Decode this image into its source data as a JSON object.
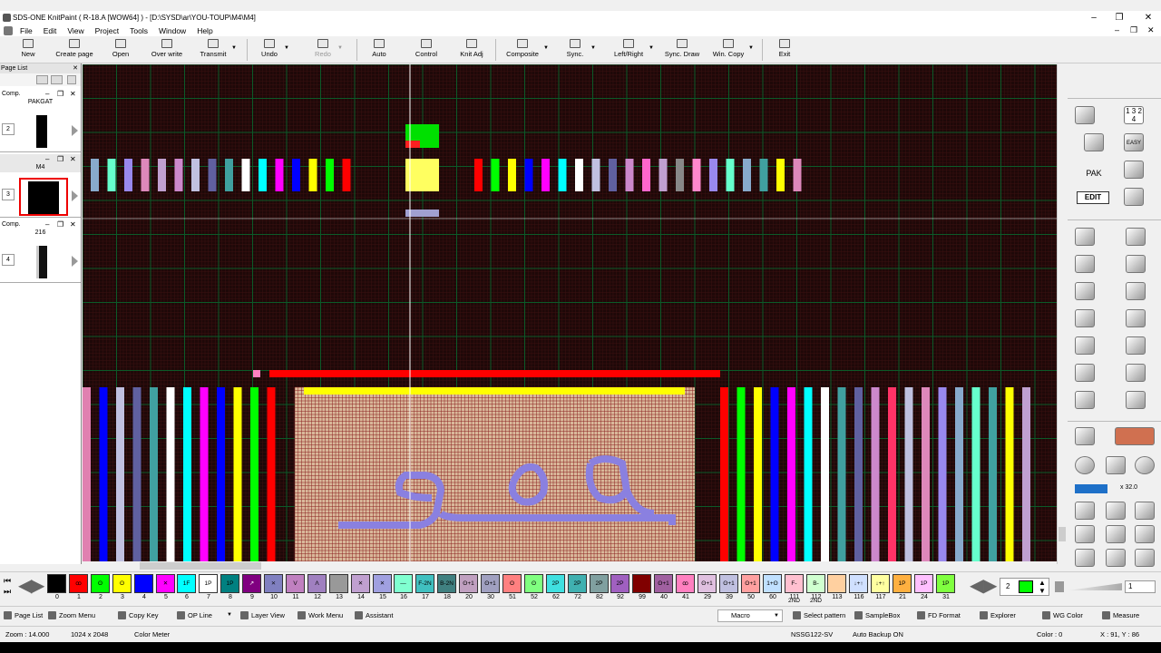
{
  "window": {
    "title": "SDS-ONE KnitPaint ( R-18.A [WOW64] ) - [D:\\SYSD\\ar\\YOU-TOUP\\M4\\M4]",
    "minimize": "–",
    "maximize": "❐",
    "close": "✕"
  },
  "menu": {
    "items": [
      "File",
      "Edit",
      "View",
      "Project",
      "Tools",
      "Window",
      "Help"
    ],
    "win_min": "–",
    "win_max": "❐",
    "win_close": "✕"
  },
  "toolbar": {
    "new": "New",
    "create_page": "Create page",
    "open": "Open",
    "overwrite": "Over write",
    "transmit": "Transmit",
    "undo": "Undo",
    "redo": "Redo",
    "auto": "Auto",
    "control": "Control",
    "knit_adj": "Knit Adj",
    "composite": "Composite",
    "sync": "Sync.",
    "left_right": "Left/Right",
    "sync_draw": "Sync. Draw",
    "win_copy": "Win. Copy",
    "exit": "Exit"
  },
  "page_list": {
    "title": "Page List",
    "pages": [
      {
        "tag": "Comp.",
        "name": "PAKGAT",
        "number": "2"
      },
      {
        "tag": "",
        "name": "M4",
        "number": "3"
      },
      {
        "tag": "Comp.",
        "name": "216",
        "number": "4"
      }
    ]
  },
  "right_panel": {
    "pak_label": "PAK",
    "edit_label": "EDIT",
    "easy_label": "EASY",
    "numbers_label": "1 3 2 4",
    "zoom_scale": "x 32.0"
  },
  "palette": {
    "colors": [
      {
        "label": "0",
        "bg": "#000000",
        "sym": ""
      },
      {
        "label": "1",
        "bg": "#ff0000",
        "sym": "ꝏ"
      },
      {
        "label": "2",
        "bg": "#00ff00",
        "sym": "ʘ"
      },
      {
        "label": "3",
        "bg": "#ffff00",
        "sym": "ʘ"
      },
      {
        "label": "4",
        "bg": "#0000ff",
        "sym": ""
      },
      {
        "label": "5",
        "bg": "#ff00ff",
        "sym": "✕"
      },
      {
        "label": "6",
        "bg": "#00ffff",
        "sym": "1F"
      },
      {
        "label": "7",
        "bg": "#ffffff",
        "sym": "1P"
      },
      {
        "label": "8",
        "bg": "#008080",
        "sym": "1P"
      },
      {
        "label": "9",
        "bg": "#800080",
        "sym": "↗"
      },
      {
        "label": "10",
        "bg": "#8080c0",
        "sym": "⨯"
      },
      {
        "label": "11",
        "bg": "#c080c0",
        "sym": "V"
      },
      {
        "label": "12",
        "bg": "#a080c0",
        "sym": "Λ"
      },
      {
        "label": "13",
        "bg": "#999999",
        "sym": ""
      },
      {
        "label": "14",
        "bg": "#c0a0d0",
        "sym": "✕"
      },
      {
        "label": "15",
        "bg": "#a0a0e0",
        "sym": "✕"
      },
      {
        "label": "16",
        "bg": "#80ffd0",
        "sym": "—"
      },
      {
        "label": "17",
        "bg": "#40c0c0",
        "sym": "F-2N"
      },
      {
        "label": "18",
        "bg": "#408080",
        "sym": "B-2N"
      },
      {
        "label": "20",
        "bg": "#c0a0c0",
        "sym": "ʘ+1"
      },
      {
        "label": "30",
        "bg": "#a0a0c0",
        "sym": "ʘ+1"
      },
      {
        "label": "51",
        "bg": "#ff8080",
        "sym": "ʘ"
      },
      {
        "label": "52",
        "bg": "#80ff80",
        "sym": "ʘ"
      },
      {
        "label": "62",
        "bg": "#40e0e0",
        "sym": "2P"
      },
      {
        "label": "72",
        "bg": "#40b0b0",
        "sym": "2P"
      },
      {
        "label": "82",
        "bg": "#80a0a0",
        "sym": "2P"
      },
      {
        "label": "92",
        "bg": "#a060c0",
        "sym": "2P"
      },
      {
        "label": "99",
        "bg": "#800000",
        "sym": ""
      },
      {
        "label": "40",
        "bg": "#a060a0",
        "sym": "ʘ+1"
      },
      {
        "label": "41",
        "bg": "#ff80c0",
        "sym": "ꝏ"
      },
      {
        "label": "29",
        "bg": "#e0c0e0",
        "sym": "ʘ+1"
      },
      {
        "label": "39",
        "bg": "#c0c0e0",
        "sym": "ʘ+1"
      },
      {
        "label": "50",
        "bg": "#ffa0a0",
        "sym": "ʘ+1"
      },
      {
        "label": "60",
        "bg": "#c0e0ff",
        "sym": "1+ʘ"
      },
      {
        "label": "111",
        "bg": "#ffc0d0",
        "sym": "F-2ND"
      },
      {
        "label": "112",
        "bg": "#d0ffd0",
        "sym": "B-2ND"
      },
      {
        "label": "113",
        "bg": "#ffd0a0",
        "sym": ""
      },
      {
        "label": "116",
        "bg": "#d0e0ff",
        "sym": "↓+↑"
      },
      {
        "label": "117",
        "bg": "#ffffa0",
        "sym": "↓+↑"
      },
      {
        "label": "21",
        "bg": "#ffb040",
        "sym": "1P"
      },
      {
        "label": "24",
        "bg": "#ffc0ff",
        "sym": "1P"
      },
      {
        "label": "31",
        "bg": "#80ff40",
        "sym": "1P"
      }
    ],
    "selected_index": "2",
    "selected_color": "#00ff00",
    "yarn_value": "1"
  },
  "bottom_tools": {
    "page_list": "Page List",
    "zoom_menu": "Zoom Menu",
    "copy_key": "Copy Key",
    "op_line": "OP Line",
    "layer_view": "Layer View",
    "work_menu": "Work Menu",
    "assistant": "Assistant",
    "macro": "Macro",
    "select_pattern": "Select pattern",
    "sample_box": "SampleBox",
    "fd_format": "FD Format",
    "explorer": "Explorer",
    "wg_color": "WG Color",
    "measure": "Measure"
  },
  "status": {
    "zoom": "Zoom : 14.000",
    "size": "1024 x 2048",
    "color_meter": "Color Meter",
    "machine": "NSSG122-SV",
    "backup": "Auto Backup ON",
    "color": "Color :   0",
    "coords": "X :    91, Y :    86"
  }
}
